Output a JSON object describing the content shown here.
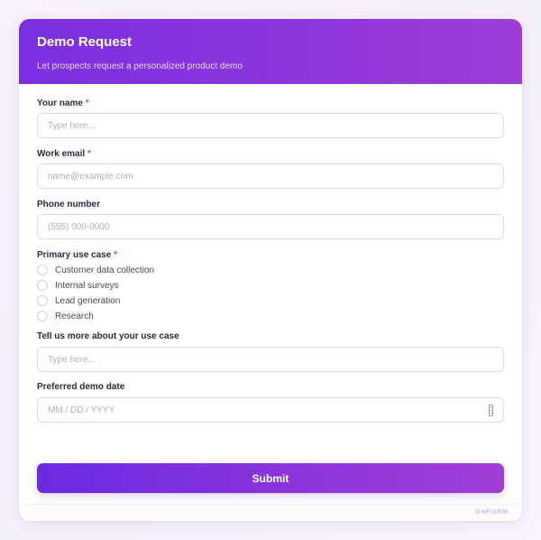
{
  "header": {
    "title": "Demo Request",
    "subtitle": "Let prospects request a personalized product demo"
  },
  "fields": {
    "name": {
      "label": "Your name",
      "required_mark": "*",
      "placeholder": "Type here..."
    },
    "email": {
      "label": "Work email",
      "required_mark": "*",
      "placeholder": "name@example.com"
    },
    "phone": {
      "label": "Phone number",
      "placeholder": "(555) 000-0000"
    },
    "use_case": {
      "label": "Primary use case",
      "required_mark": "*",
      "options": [
        "Customer data collection",
        "Internal surveys",
        "Lead generation",
        "Research"
      ]
    },
    "details": {
      "label": "Tell us more about your use case",
      "placeholder": "Type here..."
    },
    "date": {
      "label": "Preferred demo date",
      "placeholder": "MM / DD / YYYY",
      "icon": "calendar-icon"
    }
  },
  "submit_label": "Submit",
  "footer": {
    "brand": "ONFORM"
  },
  "colors": {
    "accent": "#7a2fe0",
    "accent_end": "#a13fd6",
    "required": "#e0415a"
  }
}
